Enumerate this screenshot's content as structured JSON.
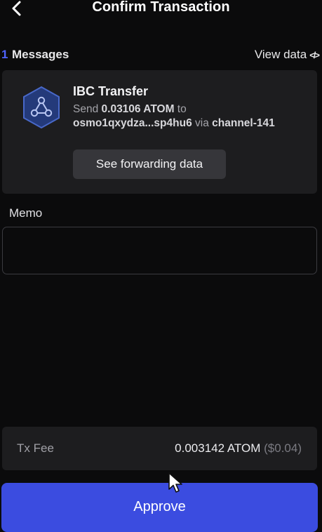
{
  "header": {
    "title": "Confirm Transaction",
    "back_icon": "chevron-left-icon"
  },
  "messages": {
    "count": "1",
    "label": "Messages",
    "view_data_label": "View data",
    "view_data_icon": "code-icon",
    "items": [
      {
        "icon": "ibc-transfer-icon",
        "title": "IBC Transfer",
        "send_prefix": "Send",
        "amount": "0.03106 ATOM",
        "to_word": "to",
        "recipient": "osmo1qxydza...sp4hu6",
        "via_word": "via",
        "channel": "channel-141",
        "forward_button": "See forwarding data"
      }
    ]
  },
  "memo": {
    "label": "Memo",
    "value": "",
    "placeholder": ""
  },
  "fee": {
    "label": "Tx Fee",
    "amount": "0.003142 ATOM",
    "usd": "($0.04)"
  },
  "actions": {
    "approve_label": "Approve"
  },
  "colors": {
    "background": "#0b0b0c",
    "card": "#1d1d1f",
    "accent": "#3b4ce0",
    "count_accent": "#4f63ff"
  }
}
